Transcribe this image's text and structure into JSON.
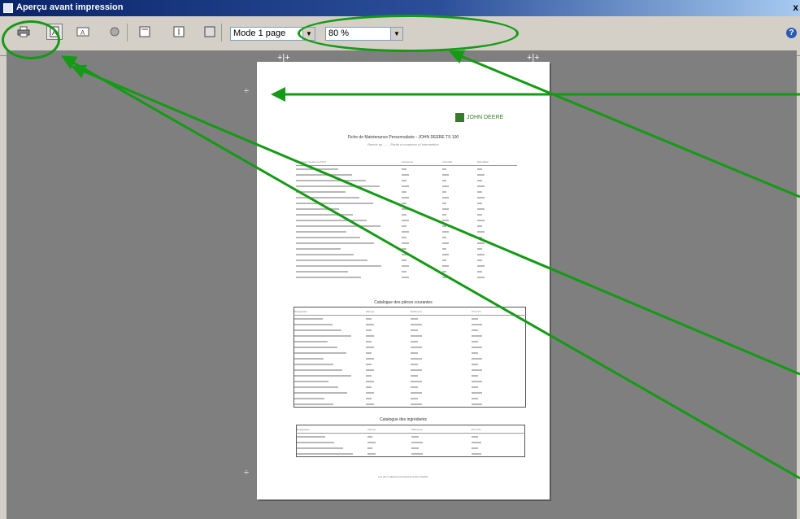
{
  "window": {
    "title": "Aperçu avant impression",
    "close_glyph": "x"
  },
  "toolbar": {
    "page_mode": "Mode 1 page",
    "zoom": "80 %",
    "icons": [
      "printer-icon",
      "portrait-icon",
      "landscape-icon",
      "page-setup-icon",
      "single-page-icon",
      "multi-page-icon",
      "fit-page-icon",
      "help-icon"
    ]
  },
  "page": {
    "brand": "JOHN DEERE",
    "doc_title": "Fiche de Maintenance Personnalisée - JOHN DEERE TS 100",
    "doc_subtitle": "Relevé au ..... - Partie à conserver à l'intervention",
    "maintenance": {
      "headers": [
        "Opérations (toutes les 50 h)",
        "Fréquence",
        "Intervalle",
        "Périodicité"
      ],
      "rows": 20
    },
    "parts": {
      "title": "Catalogue des pièces courantes",
      "headers": [
        "Désignation",
        "Marque",
        "Référence",
        "Prix TTC"
      ],
      "rows": 16
    },
    "fluids": {
      "title": "Catalogue des ingrédients",
      "headers": [
        "Désignation",
        "Volume",
        "Référence",
        "Prix TTC"
      ],
      "rows": 4
    },
    "footer": "Les prix ci-dessus sont donnés à titre indicatif."
  },
  "annotation_color": "#149a14"
}
